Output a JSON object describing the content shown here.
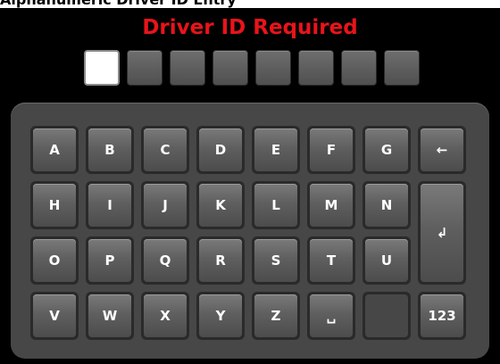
{
  "caption": "Alphanumeric Driver ID Entry",
  "title": "Driver ID Required",
  "id_slots": 8,
  "keys": {
    "a": "A",
    "b": "B",
    "c": "C",
    "d": "D",
    "e": "E",
    "f": "F",
    "g": "G",
    "backspace": "←",
    "h": "H",
    "i": "I",
    "j": "J",
    "k": "K",
    "l": "L",
    "m": "M",
    "n": "N",
    "enter": "↲",
    "o": "O",
    "p": "P",
    "q": "Q",
    "r": "R",
    "s": "S",
    "t": "T",
    "u": "U",
    "v": "V",
    "w": "W",
    "x": "X",
    "y": "Y",
    "z": "Z",
    "space": "␣",
    "numeric": "123"
  },
  "colors": {
    "title": "#e8141a",
    "screen": "#000000",
    "keyboard_panel": "#474747"
  }
}
